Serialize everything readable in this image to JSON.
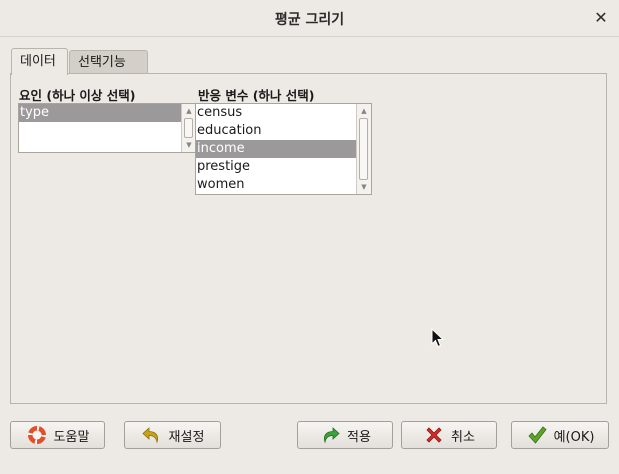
{
  "window": {
    "title": "평균 그리기"
  },
  "tabs": [
    {
      "label": "데이터",
      "active": true
    },
    {
      "label": "선택기능",
      "active": false
    }
  ],
  "factors": {
    "label": "요인 (하나 이상 선택)",
    "items": [
      "type"
    ],
    "selected": "type"
  },
  "response": {
    "label": "반응 변수 (하나 선택)",
    "items": [
      "census",
      "education",
      "income",
      "prestige",
      "women"
    ],
    "selected": "income"
  },
  "buttons": {
    "help": "도움말",
    "reset": "재설정",
    "apply": "적용",
    "cancel": "취소",
    "ok": "예(OK)"
  },
  "colors": {
    "selection": "#9c999a",
    "help_icon": "#e2502a",
    "reset_icon": "#c9a21a",
    "apply_icon": "#3aa23a",
    "cancel_icon": "#d62b2b",
    "ok_icon": "#5aa52a"
  }
}
